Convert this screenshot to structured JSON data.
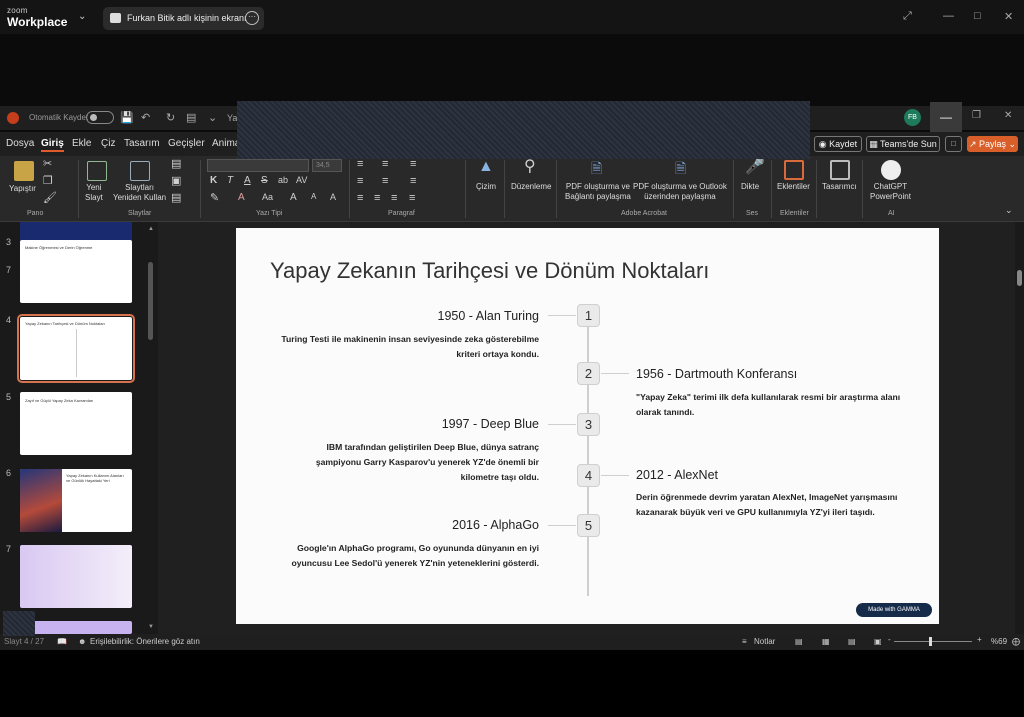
{
  "zoom": {
    "brand_small": "zoom",
    "brand_big": "Workplace",
    "share_text": "Furkan Bitik adlı kişinin ekranı"
  },
  "ppt": {
    "autosave": "Otomatik Kaydet",
    "avatar": "FB",
    "title_stub": "Ya",
    "tabs": [
      "Dosya",
      "Giriş",
      "Ekle",
      "Çiz",
      "Tasarım",
      "Geçişler",
      "Anima"
    ],
    "kaydet": "Kaydet",
    "teams": "Teams'de Sun",
    "share": "Paylaş"
  },
  "ribbon": {
    "yapistir": "Yapıştır",
    "pano": "Pano",
    "yeni_slayt_1": "Yeni",
    "yeni_slayt_2": "Slayt",
    "yeniden_1": "Slaytları",
    "yeniden_2": "Yeniden Kullan",
    "slaytlar": "Slaytlar",
    "font_size": "34,5",
    "yazi_tipi": "Yazı Tipi",
    "paragraf": "Paragraf",
    "cizim": "Çizim",
    "duzenleme": "Düzenleme",
    "pdf1_1": "PDF oluşturma ve",
    "pdf1_2": "Bağlantı paylaşma",
    "pdf2_1": "PDF oluşturma ve Outlook",
    "pdf2_2": "üzerinden paylaşma",
    "adobe": "Adobe Acrobat",
    "dikte": "Dikte",
    "ses": "Ses",
    "eklentiler": "Eklentiler",
    "eklentiler_group": "Eklentiler",
    "tasarimci": "Tasarımcı",
    "chatgpt_1": "ChatGPT",
    "chatgpt_2": "PowerPoint",
    "ai": "AI"
  },
  "thumbs": [
    {
      "num": "3"
    },
    {
      "num": "4",
      "title": "Yapay Zekanın Tarihçesi ve Dönüm Noktaları"
    },
    {
      "num": "5",
      "title": "Zayıf ve Güçlü Yapay Zeka Kavramları"
    },
    {
      "num": "6",
      "title": "Yapay Zekanın Kullanım Alanları ve Günlük Hayattaki Yeri"
    },
    {
      "num": "7",
      "title": "Makine Öğrenmesi ve Derin Öğrenme"
    }
  ],
  "slide": {
    "title": "Yapay Zekanın Tarihçesi ve Dönüm Noktaları",
    "events": [
      {
        "num": "1",
        "title": "1950 - Alan Turing",
        "desc": "Turing Testi ile makinenin insan seviyesinde zeka gösterebilme kriteri ortaya kondu."
      },
      {
        "num": "2",
        "title": "1956 - Dartmouth Konferansı",
        "desc": "\"Yapay Zeka\" terimi ilk defa kullanılarak resmi bir araştırma alanı olarak tanındı."
      },
      {
        "num": "3",
        "title": "1997 - Deep Blue",
        "desc": "IBM tarafından geliştirilen Deep Blue, dünya satranç şampiyonu Garry Kasparov'u yenerek YZ'de önemli bir kilometre taşı oldu."
      },
      {
        "num": "4",
        "title": "2012 - AlexNet",
        "desc": "Derin öğrenmede devrim yaratan AlexNet, ImageNet yarışmasını kazanarak büyük veri ve GPU kullanımıyla YZ'yi ileri taşıdı."
      },
      {
        "num": "5",
        "title": "2016 - AlphaGo",
        "desc": "Google'ın AlphaGo programı, Go oyununda dünyanın en iyi oyuncusu Lee Sedol'ü yenerek YZ'nin yeteneklerini gösterdi."
      }
    ],
    "badge": "Made with GAMMA"
  },
  "status": {
    "slide_counter": "Slayt 4 / 27",
    "accessibility": "Erişilebilirlik: Önerilere göz atın",
    "notes": "Notlar",
    "zoom": "%69"
  },
  "colors": {
    "accent": "#d95f2a",
    "gamma_badge": "#162b4a"
  }
}
